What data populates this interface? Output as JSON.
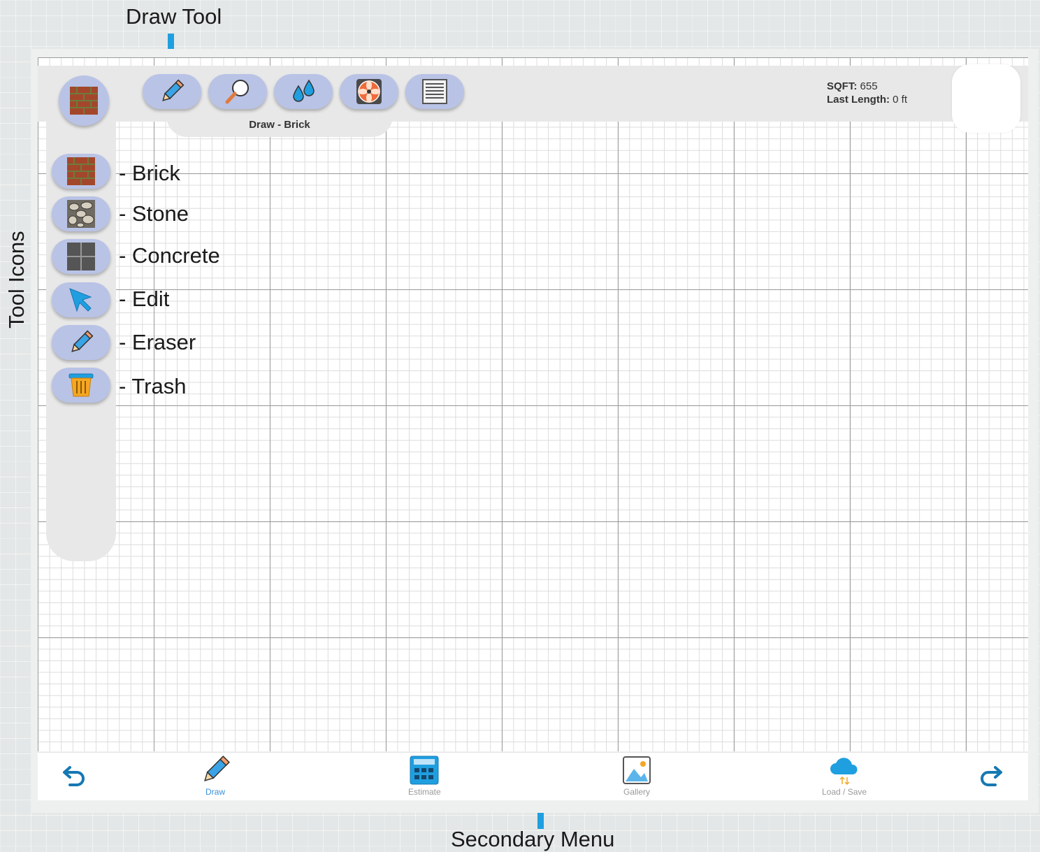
{
  "annotations": {
    "draw_tool": "Draw Tool",
    "tool_icons": "Tool Icons",
    "secondary_menu": "Secondary Menu"
  },
  "draw_toolbar": {
    "mode_label": "Draw - Brick",
    "buttons": [
      "pencil-icon",
      "magnifier-icon",
      "water-drops-icon",
      "fan-icon",
      "vent-icon"
    ]
  },
  "stats": {
    "sqft_label": "SQFT:",
    "sqft_value": "655",
    "last_length_label": "Last Length:",
    "last_length_value": "0 ft"
  },
  "tools": [
    {
      "icon": "brick-icon",
      "label": "- Brick"
    },
    {
      "icon": "stone-icon",
      "label": "- Stone"
    },
    {
      "icon": "concrete-icon",
      "label": "- Concrete"
    },
    {
      "icon": "cursor-arrow-icon",
      "label": "- Edit"
    },
    {
      "icon": "pencil-icon",
      "label": "- Eraser"
    },
    {
      "icon": "trash-bin-icon",
      "label": "- Trash"
    }
  ],
  "bottom_nav": {
    "items": [
      {
        "label": "Draw",
        "icon": "pencil-icon",
        "active": true
      },
      {
        "label": "Estimate",
        "icon": "calculator-icon",
        "active": false
      },
      {
        "label": "Gallery",
        "icon": "image-icon",
        "active": false
      },
      {
        "label": "Load / Save",
        "icon": "cloud-icon",
        "active": false
      }
    ],
    "undo_icon": "undo-arrow-icon",
    "redo_icon": "redo-arrow-icon"
  },
  "colors": {
    "accent": "#1f9fe0",
    "button_fill": "#b9c3e6",
    "panel": "#e8e8e8",
    "active_nav": "#3a8fd9"
  }
}
